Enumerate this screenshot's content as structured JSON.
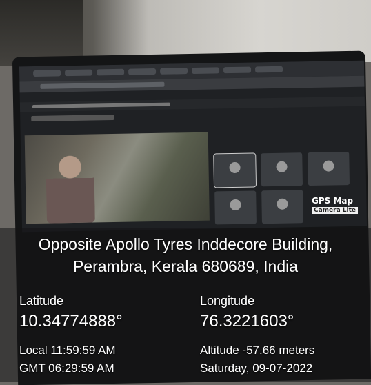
{
  "gps_badge": {
    "title": "GPS Map",
    "subtitle": "Camera Lite"
  },
  "address": {
    "line1": "Opposite Apollo Tyres Inddecore Building,",
    "line2": "Perambra, Kerala 680689, India"
  },
  "coordinates": {
    "latitude_label": "Latitude",
    "latitude_value": "10.34774888°",
    "longitude_label": "Longitude",
    "longitude_value": "76.3221603°"
  },
  "time": {
    "local": "Local 11:59:59 AM",
    "gmt": "GMT 06:29:59 AM"
  },
  "details": {
    "altitude": "Altitude -57.66 meters",
    "date": "Saturday, 09-07-2022"
  }
}
